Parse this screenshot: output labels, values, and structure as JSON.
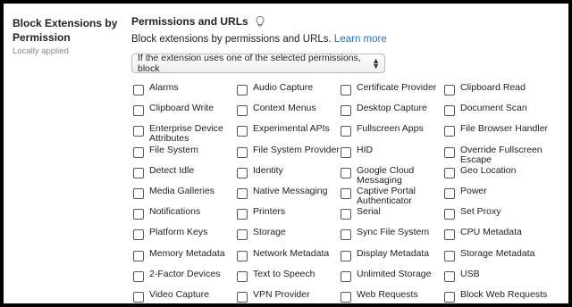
{
  "policy": {
    "title": "Block Extensions by Permission",
    "status": "Locally applied"
  },
  "section": {
    "title": "Permissions and URLs",
    "icon": "lightbulb-icon",
    "description": "Block extensions by permissions and URLs.",
    "learn_more": "Learn more"
  },
  "dropdown": {
    "selected": "If the extension uses one of the selected permissions, block"
  },
  "permissions": [
    "Alarms",
    "Audio Capture",
    "Certificate Provider",
    "Clipboard Read",
    "Clipboard Write",
    "Context Menus",
    "Desktop Capture",
    "Document Scan",
    "Enterprise Device\nAttributes",
    "Experimental APIs",
    "Fullscreen Apps",
    "File Browser Handler",
    "File System",
    "File System Provider",
    "HID",
    "Override Fullscreen\nEscape",
    "Detect Idle",
    "Identity",
    "Google Cloud\nMessaging",
    "Geo Location",
    "Media Galleries",
    "Native Messaging",
    "Captive Portal\nAuthenticator",
    "Power",
    "Notifications",
    "Printers",
    "Serial",
    "Set Proxy",
    "Platform Keys",
    "Storage",
    "Sync File System",
    "CPU Metadata",
    "Memory Metadata",
    "Network Metadata",
    "Display Metadata",
    "Storage Metadata",
    "2-Factor Devices",
    "Text to Speech",
    "Unlimited Storage",
    "USB",
    "Video Capture",
    "VPN Provider",
    "Web Requests",
    "Block Web Requests"
  ]
}
